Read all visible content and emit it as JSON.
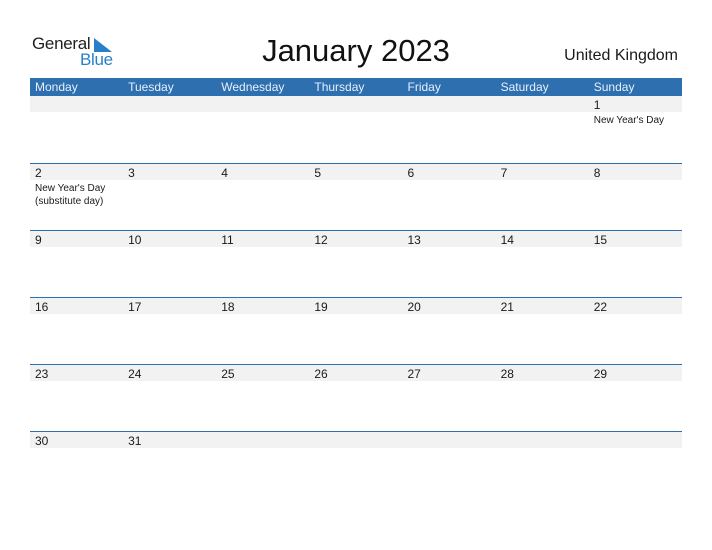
{
  "logo": {
    "text_general": "General",
    "text_blue": "Blue",
    "brand_color": "#2a7fc9"
  },
  "title": "January 2023",
  "country": "United Kingdom",
  "colors": {
    "header_bg": "#2e6fb0",
    "band_bg": "#f2f2f2"
  },
  "weekdays": [
    "Monday",
    "Tuesday",
    "Wednesday",
    "Thursday",
    "Friday",
    "Saturday",
    "Sunday"
  ],
  "weeks": [
    [
      {
        "day": ""
      },
      {
        "day": ""
      },
      {
        "day": ""
      },
      {
        "day": ""
      },
      {
        "day": ""
      },
      {
        "day": ""
      },
      {
        "day": "1",
        "holiday": "New Year's Day"
      }
    ],
    [
      {
        "day": "2",
        "holiday": "New Year's Day",
        "holiday2": "(substitute day)"
      },
      {
        "day": "3"
      },
      {
        "day": "4"
      },
      {
        "day": "5"
      },
      {
        "day": "6"
      },
      {
        "day": "7"
      },
      {
        "day": "8"
      }
    ],
    [
      {
        "day": "9"
      },
      {
        "day": "10"
      },
      {
        "day": "11"
      },
      {
        "day": "12"
      },
      {
        "day": "13"
      },
      {
        "day": "14"
      },
      {
        "day": "15"
      }
    ],
    [
      {
        "day": "16"
      },
      {
        "day": "17"
      },
      {
        "day": "18"
      },
      {
        "day": "19"
      },
      {
        "day": "20"
      },
      {
        "day": "21"
      },
      {
        "day": "22"
      }
    ],
    [
      {
        "day": "23"
      },
      {
        "day": "24"
      },
      {
        "day": "25"
      },
      {
        "day": "26"
      },
      {
        "day": "27"
      },
      {
        "day": "28"
      },
      {
        "day": "29"
      }
    ],
    [
      {
        "day": "30"
      },
      {
        "day": "31"
      },
      {
        "day": ""
      },
      {
        "day": ""
      },
      {
        "day": ""
      },
      {
        "day": ""
      },
      {
        "day": ""
      }
    ]
  ]
}
